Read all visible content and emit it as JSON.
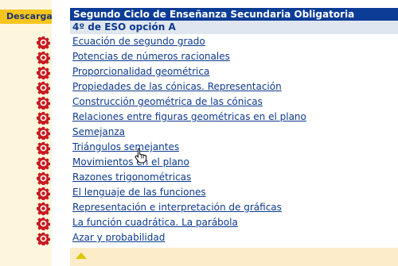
{
  "sidebar": {
    "tab_label": "Descarga"
  },
  "main": {
    "header": "Segundo Ciclo de Enseñanza Secundaria Obligatoria",
    "subheader": "4º de ESO opción A",
    "links": [
      "Ecuación de segundo grado",
      "Potencias de números racionales",
      "Proporcionalidad geométrica",
      "Propiedades de las cónicas. Representación",
      "Construcción geométrica de las cónicas",
      "Relaciones entre figuras geométricas en el plano",
      "Semejanza",
      "Triángulos semejantes",
      "Movimientos en el plano",
      "Razones trigonométricas",
      "El lenguaje de las funciones",
      "Representación e interpretación de gráficas",
      "La función cuadrática. La parábola",
      "Azar y probabilidad"
    ]
  },
  "icons": {
    "download": "gear-icon",
    "back_to_top": "up-arrow-icon",
    "cursor": "hand-cursor-icon"
  },
  "colors": {
    "header_bg": "#0b3c96",
    "subheader_bg": "#dfe6ef",
    "link": "#0c3a8e",
    "tab_bg": "#f7c51e",
    "gear": "#c8191e",
    "bottom_bar": "#fcecc9"
  }
}
